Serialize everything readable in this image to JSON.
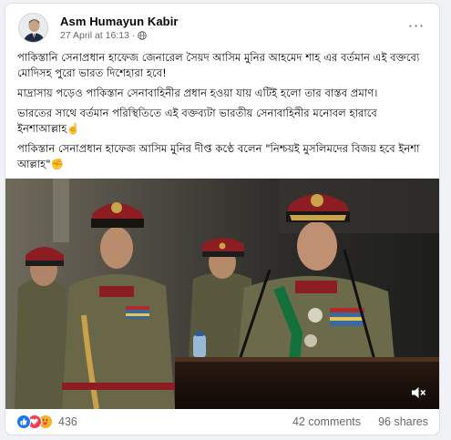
{
  "post": {
    "author": "Asm Humayun Kabir",
    "timestamp": "27 April at 16:13",
    "separator": "·",
    "privacy_icon": "globe-icon",
    "more_label": "···",
    "paragraphs": [
      "পাকিস্তানি সেনাপ্রধান হাফেজ জেনারেল সৈয়দ আসিম মুনির আহমেদ শাহ এর বর্তমান এই বক্তব্যে মোদিসহ পুরো ভারত দিশেহারা হবে!",
      "মাদ্রাসায় পড়েও পাকিস্তান সেনাবাহিনীর প্রধান হওয়া যায় এটিই হলো তার বাস্তব প্রমাণ।",
      "ভারতের সাথে বর্তমান পরিস্থিতিতে এই বক্তব্যটা ভারতীয় সেনাবাহিনীর মনোবল হারাবে ইনশাআল্লাহ☝️",
      "পাকিস্তান সেনাপ্রধান হাফেজ আসিম মুনির দীপ্ত কণ্ঠে বলেন \"নিশ্চয়ই মুসলিমদের বিজয় হবে ইনশা আল্লাহ\"✊"
    ]
  },
  "media": {
    "type": "video",
    "volume_icon": "speaker-muted-icon"
  },
  "stats": {
    "reaction_icons": [
      "like-icon",
      "love-icon",
      "care-icon"
    ],
    "reaction_count": "436",
    "comments": "42 comments",
    "shares": "96 shares"
  },
  "colors": {
    "like": "#1877f2",
    "love": "#f33e58",
    "care": "#f7b125",
    "secondary_text": "#65676b",
    "card_bg": "#ffffff",
    "page_bg": "#f0f2f5"
  }
}
